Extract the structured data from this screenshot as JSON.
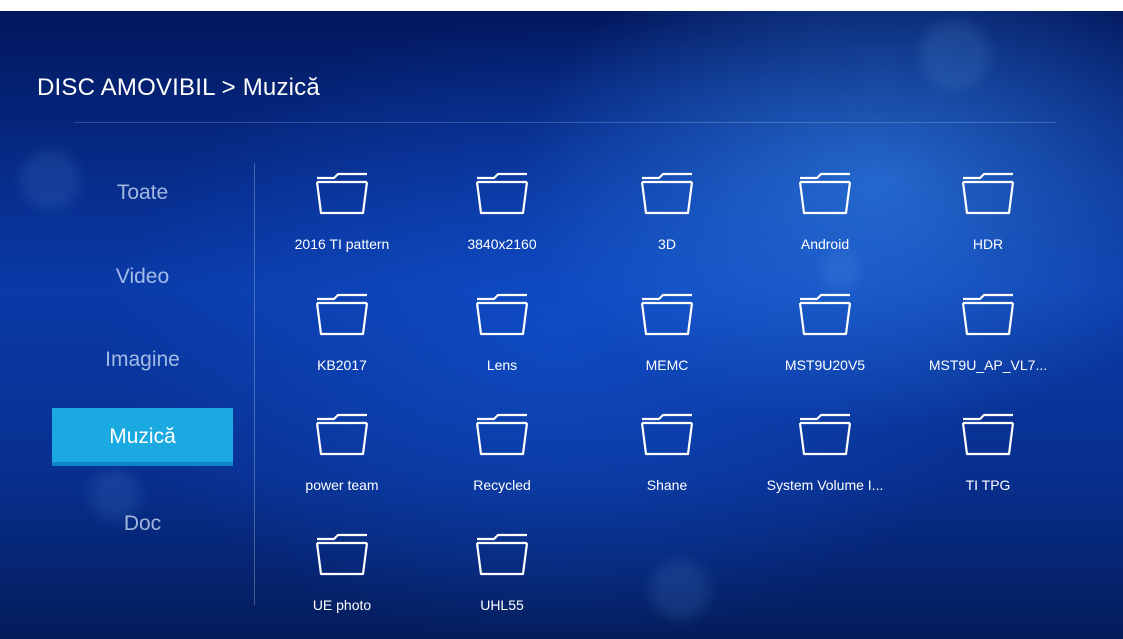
{
  "top_bar_text": "",
  "breadcrumb": "DISC AMOVIBIL > Muzică",
  "sidebar": {
    "items": [
      {
        "label": "Toate",
        "active": false
      },
      {
        "label": "Video",
        "active": false
      },
      {
        "label": "Imagine",
        "active": false
      },
      {
        "label": "Muzică",
        "active": true
      },
      {
        "label": "Doc",
        "active": false
      }
    ]
  },
  "folders": [
    {
      "name": "2016 TI pattern"
    },
    {
      "name": "3840x2160"
    },
    {
      "name": "3D"
    },
    {
      "name": "Android"
    },
    {
      "name": "HDR"
    },
    {
      "name": "KB2017"
    },
    {
      "name": "Lens"
    },
    {
      "name": "MEMC"
    },
    {
      "name": "MST9U20V5"
    },
    {
      "name": "MST9U_AP_VL7..."
    },
    {
      "name": "power team"
    },
    {
      "name": "Recycled"
    },
    {
      "name": "Shane"
    },
    {
      "name": "System Volume I..."
    },
    {
      "name": "TI TPG"
    },
    {
      "name": "UE photo"
    },
    {
      "name": "UHL55"
    }
  ],
  "icons": {
    "folder": "folder-icon"
  },
  "colors": {
    "accent": "#1aa9e0",
    "background": "#0a3aa8",
    "text": "#ffffff"
  }
}
